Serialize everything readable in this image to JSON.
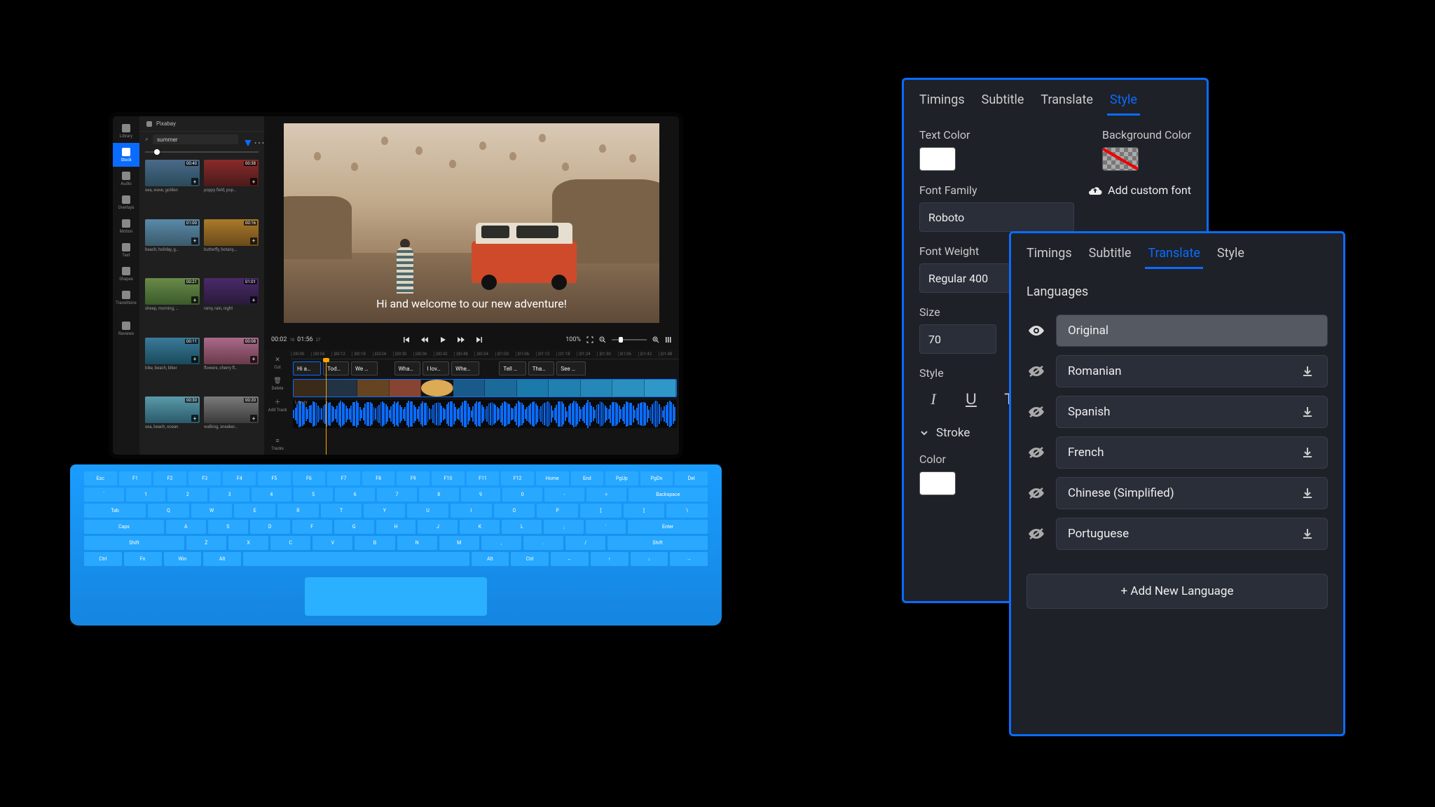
{
  "laptop": {
    "sidebar": {
      "items": [
        {
          "label": "Library"
        },
        {
          "label": "Stock"
        },
        {
          "label": "Audio"
        },
        {
          "label": "Overlays"
        },
        {
          "label": "Motion"
        },
        {
          "label": "Text"
        },
        {
          "label": "Shapes"
        },
        {
          "label": "Transitions"
        },
        {
          "label": "Reviews"
        }
      ]
    },
    "library": {
      "source": "Pixabay",
      "search_value": "summer",
      "thumbs": [
        {
          "duration": "00:40",
          "label": "sea, wave, golden"
        },
        {
          "duration": "00:38",
          "label": "poppy field, pop…"
        },
        {
          "duration": "01:00",
          "label": "beach, holiday, g…"
        },
        {
          "duration": "00:16",
          "label": "butterfly, botany,…"
        },
        {
          "duration": "00:21",
          "label": "sheep, morning, …"
        },
        {
          "duration": "01:01",
          "label": "rainy, rain, night"
        },
        {
          "duration": "00:11",
          "label": "bike, beach, biker"
        },
        {
          "duration": "00:08",
          "label": "flowers, cherry fl…"
        },
        {
          "duration": "00:30",
          "label": "sea, beach, ocean"
        },
        {
          "duration": "00:20",
          "label": "walking, sneaker…"
        }
      ]
    },
    "preview": {
      "subtitle_text": "Hi and welcome to our new adventure!"
    },
    "playbar": {
      "current": "00:02",
      "current_frame": "18",
      "total": "01:56",
      "total_frame": "27",
      "zoom": "100%"
    },
    "timeline": {
      "tools": [
        {
          "label": "Cut"
        },
        {
          "label": "Delete"
        },
        {
          "label": "Add Track"
        },
        {
          "label": "Tracks"
        }
      ],
      "ruler": [
        "|00:00",
        "|00:06",
        "|00:12",
        "|00:18",
        "|00:24",
        "|00:30",
        "|00:36",
        "|00:42",
        "|00:48",
        "|00:54",
        "|01:00",
        "|01:06",
        "|01:12",
        "|01:18",
        "|01:24",
        "|01:30",
        "|01:36",
        "|01:42",
        "|01:48"
      ],
      "sub_clips": [
        "Hi a…",
        "Tod…",
        "We …",
        "Wha…",
        "I lov…",
        "Whe…",
        "Tell …",
        "Tha…",
        "See …"
      ],
      "audio_label": "Luxury"
    },
    "keyboard_rows": [
      [
        "Esc",
        "F1",
        "F2",
        "F3",
        "F4",
        "F5",
        "F6",
        "F7",
        "F8",
        "F9",
        "F10",
        "F11",
        "F12",
        "Home",
        "End",
        "PgUp",
        "PgDn",
        "Del"
      ],
      [
        "`",
        "1",
        "2",
        "3",
        "4",
        "5",
        "6",
        "7",
        "8",
        "9",
        "0",
        "-",
        "=",
        "Backspace"
      ],
      [
        "Tab",
        "Q",
        "W",
        "E",
        "R",
        "T",
        "Y",
        "U",
        "I",
        "O",
        "P",
        "[",
        "]",
        "\\"
      ],
      [
        "Caps",
        "A",
        "S",
        "D",
        "F",
        "G",
        "H",
        "J",
        "K",
        "L",
        ";",
        "'",
        "Enter"
      ],
      [
        "Shift",
        "Z",
        "X",
        "C",
        "V",
        "B",
        "N",
        "M",
        ",",
        ".",
        "/",
        "Shift"
      ],
      [
        "Ctrl",
        "Fn",
        "Win",
        "Alt",
        "",
        "Alt",
        "Ctrl",
        "←",
        "↑",
        "↓",
        "→"
      ]
    ]
  },
  "style_panel": {
    "tabs": [
      "Timings",
      "Subtitle",
      "Translate",
      "Style"
    ],
    "active_tab": "Style",
    "text_color_label": "Text Color",
    "bg_color_label": "Background Color",
    "font_family_label": "Font Family",
    "add_font_label": "Add custom font",
    "font_family_value": "Roboto",
    "font_weight_label": "Font Weight",
    "font_weight_value": "Regular 400",
    "size_label": "Size",
    "size_value": "70",
    "style_label": "Style",
    "stroke_label": "Stroke",
    "color_label": "Color"
  },
  "translate_panel": {
    "tabs": [
      "Timings",
      "Subtitle",
      "Translate",
      "Style"
    ],
    "active_tab": "Translate",
    "languages_label": "Languages",
    "languages": [
      {
        "name": "Original",
        "visible": true,
        "active": true
      },
      {
        "name": "Romanian",
        "visible": false
      },
      {
        "name": "Spanish",
        "visible": false
      },
      {
        "name": "French",
        "visible": false
      },
      {
        "name": "Chinese (Simplified)",
        "visible": false
      },
      {
        "name": "Portuguese",
        "visible": false
      }
    ],
    "add_label": "+ Add New Language"
  }
}
